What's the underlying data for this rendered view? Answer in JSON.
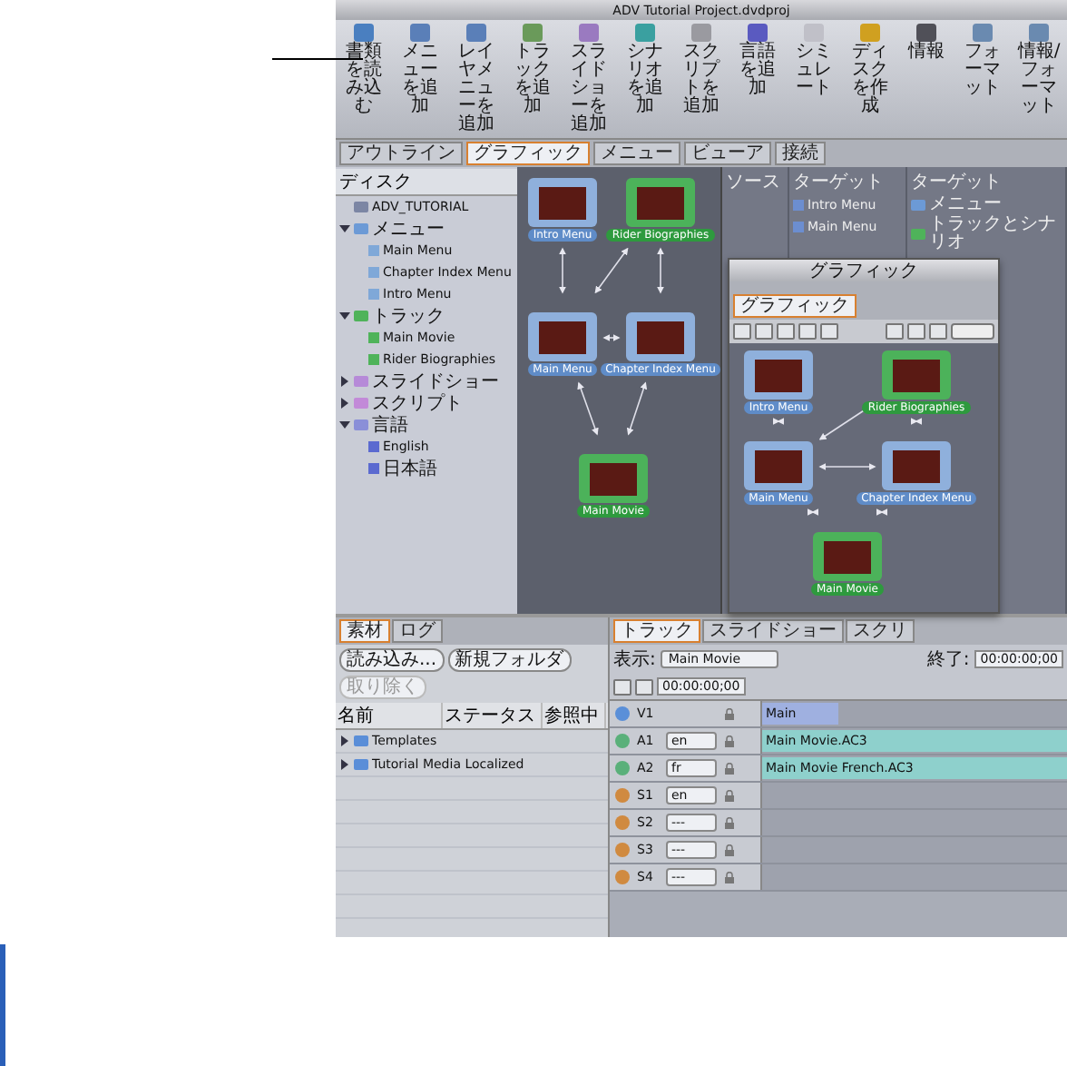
{
  "window": {
    "title": "ADV Tutorial Project.dvdproj"
  },
  "toolbar": [
    {
      "label": "書類を読み込む",
      "kind": "import"
    },
    {
      "label": "メニューを追加",
      "kind": "menu"
    },
    {
      "label": "レイヤメニューを追加",
      "kind": "menu"
    },
    {
      "label": "トラックを追加",
      "kind": "track"
    },
    {
      "label": "スライドショーを追加",
      "kind": "slide"
    },
    {
      "label": "シナリオを追加",
      "kind": "story"
    },
    {
      "label": "スクリプトを追加",
      "kind": "script"
    },
    {
      "label": "言語を追加",
      "kind": "lang"
    },
    {
      "label": "シミュレート",
      "kind": "sim"
    },
    {
      "label": "ディスクを作成",
      "kind": "burn"
    },
    {
      "label": "情報",
      "kind": "info"
    },
    {
      "label": "フォーマット",
      "kind": "format"
    },
    {
      "label": "情報/フォーマット",
      "kind": "format"
    }
  ],
  "tabs": [
    {
      "label": "アウトライン",
      "selected": false
    },
    {
      "label": "グラフィック",
      "selected": true
    },
    {
      "label": "メニュー",
      "selected": false
    },
    {
      "label": "ビューア",
      "selected": false
    },
    {
      "label": "接続",
      "selected": false
    }
  ],
  "outline": {
    "header": "ディスク",
    "items": [
      {
        "label": "ADV_TUTORIAL",
        "kind": "disc"
      },
      {
        "label": "メニュー",
        "kind": "menu-folder",
        "expanded": true,
        "children": [
          {
            "label": "Main Menu",
            "kind": "menu"
          },
          {
            "label": "Chapter Index Menu",
            "kind": "menu"
          },
          {
            "label": "Intro Menu",
            "kind": "menu"
          }
        ]
      },
      {
        "label": "トラック",
        "kind": "track-folder",
        "expanded": true,
        "children": [
          {
            "label": "Main Movie",
            "kind": "track"
          },
          {
            "label": "Rider Biographies",
            "kind": "track"
          }
        ]
      },
      {
        "label": "スライドショー",
        "kind": "slide-folder",
        "expanded": false
      },
      {
        "label": "スクリプト",
        "kind": "script-folder",
        "expanded": false
      },
      {
        "label": "言語",
        "kind": "lang-folder",
        "expanded": true,
        "children": [
          {
            "label": "English",
            "kind": "lang"
          },
          {
            "label": "日本語",
            "kind": "lang"
          }
        ]
      }
    ]
  },
  "graphic_nodes": [
    {
      "label": "Intro Menu",
      "kind": "menu"
    },
    {
      "label": "Rider Biographies",
      "kind": "track"
    },
    {
      "label": "Main Menu",
      "kind": "menu"
    },
    {
      "label": "Chapter Index Menu",
      "kind": "menu"
    },
    {
      "label": "Main Movie",
      "kind": "track"
    }
  ],
  "connections": {
    "source_header": "ソース",
    "target_header": "ターゲット",
    "targets": [
      "Intro Menu",
      "Main Menu"
    ],
    "target_header_2": "ターゲット",
    "targets_2": [
      {
        "label": "メニュー",
        "kind": "menu-folder"
      },
      {
        "label": "トラックとシナリオ",
        "kind": "track-folder"
      }
    ]
  },
  "graphic_window": {
    "title": "グラフィック",
    "tab": "グラフィック",
    "nodes": [
      {
        "label": "Intro Menu",
        "kind": "menu"
      },
      {
        "label": "Rider Biographies",
        "kind": "track"
      },
      {
        "label": "Main Menu",
        "kind": "menu"
      },
      {
        "label": "Chapter Index Menu",
        "kind": "menu"
      },
      {
        "label": "Main Movie",
        "kind": "track"
      }
    ]
  },
  "assets": {
    "tabs": [
      {
        "label": "素材",
        "selected": true
      },
      {
        "label": "ログ",
        "selected": false
      }
    ],
    "buttons": [
      {
        "label": "読み込み...",
        "disabled": false
      },
      {
        "label": "新規フォルダ",
        "disabled": false
      },
      {
        "label": "取り除く",
        "disabled": true
      }
    ],
    "columns": [
      "名前",
      "ステータス",
      "参照中"
    ],
    "rows": [
      "Templates",
      "Tutorial Media Localized"
    ]
  },
  "timeline": {
    "tabs": [
      {
        "label": "トラック",
        "selected": true
      },
      {
        "label": "スライドショー",
        "selected": false
      },
      {
        "label": "スクリ",
        "selected": false
      }
    ],
    "view_label": "表示:",
    "view_value": "Main Movie",
    "timecode": "00:00:00;00",
    "end_label": "終了:",
    "end_timecode": "00:00:00;00",
    "tracks": [
      {
        "name": "V1",
        "kind": "video",
        "clip": "Main"
      },
      {
        "name": "A1",
        "kind": "audio",
        "lang": "en",
        "clip": "Main Movie.AC3"
      },
      {
        "name": "A2",
        "kind": "audio",
        "lang": "fr",
        "clip": "Main Movie French.AC3"
      },
      {
        "name": "S1",
        "kind": "subtitle",
        "lang": "en"
      },
      {
        "name": "S2",
        "kind": "subtitle",
        "lang": "---"
      },
      {
        "name": "S3",
        "kind": "subtitle",
        "lang": "---"
      },
      {
        "name": "S4",
        "kind": "subtitle",
        "lang": "---"
      }
    ]
  }
}
